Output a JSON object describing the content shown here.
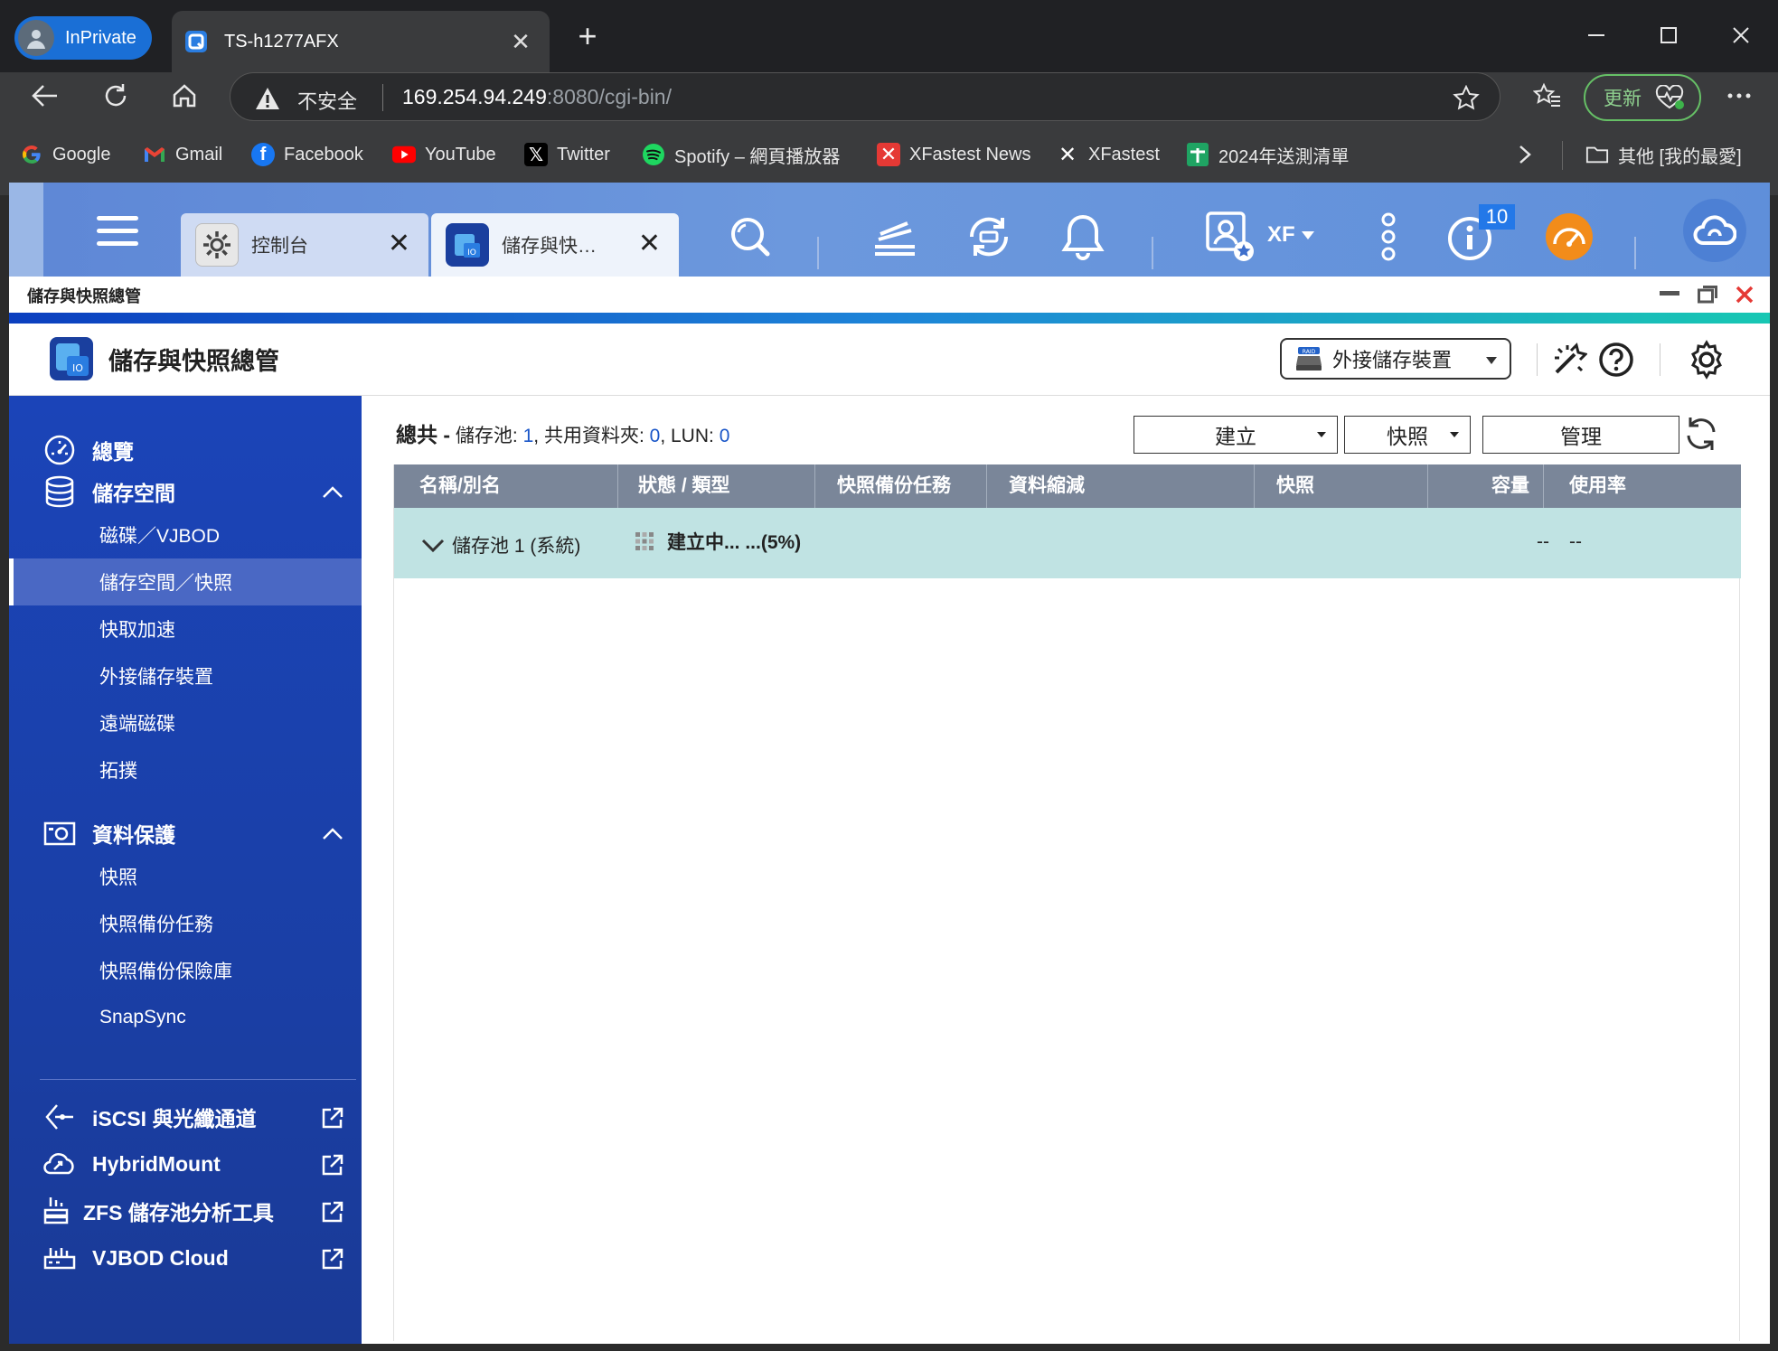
{
  "browser": {
    "inprivate_label": "InPrivate",
    "tab_title": "TS-h1277AFX",
    "address": {
      "security_label": "不安全",
      "host": "169.254.94.249",
      "rest": ":8080/cgi-bin/"
    },
    "update_label": "更新",
    "bookmarks": [
      {
        "label": "Google",
        "icon": "google-icon"
      },
      {
        "label": "Gmail",
        "icon": "gmail-icon"
      },
      {
        "label": "Facebook",
        "icon": "facebook-icon"
      },
      {
        "label": "YouTube",
        "icon": "youtube-icon"
      },
      {
        "label": "Twitter",
        "icon": "x-icon"
      },
      {
        "label": "Spotify – 網頁播放器",
        "icon": "spotify-icon"
      },
      {
        "label": "XFastest News",
        "icon": "xfastest-icon"
      },
      {
        "label": "XFastest",
        "icon": "xfastest-icon"
      },
      {
        "label": "2024年送測清單",
        "icon": "sheets-icon"
      }
    ],
    "other_bookmarks_label": "其他 [我的最愛]"
  },
  "qts": {
    "tabs": [
      {
        "label": "控制台"
      },
      {
        "label": "儲存與快…"
      }
    ],
    "user_label": "XF",
    "notification_count": "10",
    "window_title": "儲存與快照總管"
  },
  "app": {
    "title": "儲存與快照總管",
    "external_storage_label": "外接儲存裝置",
    "sidebar": {
      "overview": "總覽",
      "storage": "儲存空間",
      "storage_items": [
        "磁碟／VJBOD",
        "儲存空間／快照",
        "快取加速",
        "外接儲存裝置",
        "遠端磁碟",
        "拓撲"
      ],
      "protection": "資料保護",
      "protection_items": [
        "快照",
        "快照備份任務",
        "快照備份保險庫",
        "SnapSync"
      ],
      "links": [
        "iSCSI 與光纖通道",
        "HybridMount",
        "ZFS 儲存池分析工具",
        "VJBOD Cloud"
      ]
    },
    "summary": {
      "total": "總共 -",
      "pool_label": "儲存池:",
      "pool_count": "1",
      "share_label": "共用資料夾:",
      "share_count": "0",
      "lun_label": "LUN:",
      "lun_count": "0"
    },
    "buttons": {
      "create": "建立",
      "snapshot": "快照",
      "manage": "管理"
    },
    "columns": [
      "名稱/別名",
      "狀態 / 類型",
      "快照備份任務",
      "資料縮減",
      "快照",
      "容量",
      "使用率"
    ],
    "rows": [
      {
        "name": "儲存池 1 (系統)",
        "status": "建立中... ...(5%)",
        "capacity": "--",
        "usage": "--"
      }
    ]
  },
  "colors": {
    "sidebar_bg": "#1b44b8",
    "grid_header": "#7a8699",
    "row_selected": "#c0e3e3",
    "accent_number": "#1a56c8"
  }
}
